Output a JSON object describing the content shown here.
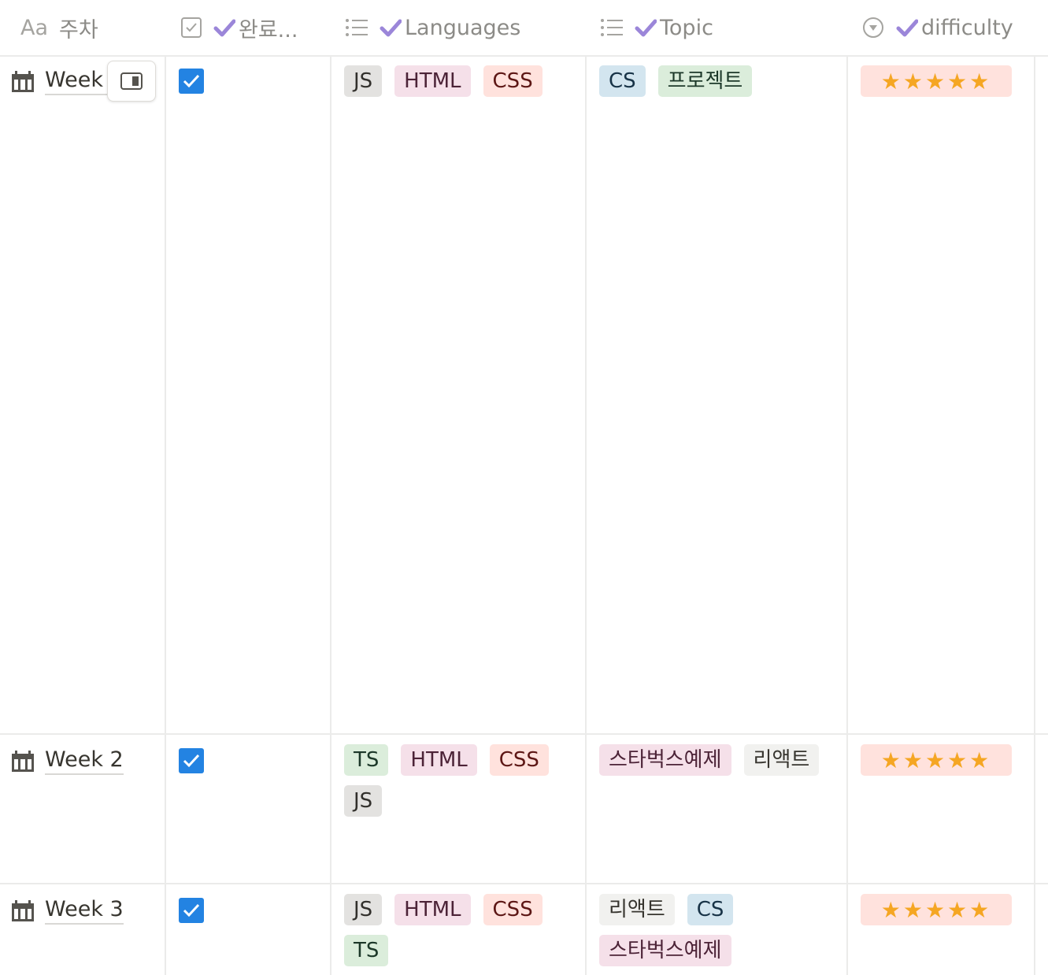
{
  "columns": {
    "name": {
      "icon": "text-icon",
      "icon_text": "Aa",
      "label": "주차"
    },
    "done": {
      "icon": "checkbox-icon",
      "label": "완료..."
    },
    "languages": {
      "icon": "list-icon",
      "label": "Languages"
    },
    "topic": {
      "icon": "list-icon",
      "label": "Topic"
    },
    "difficulty": {
      "icon": "select-icon",
      "label": "difficulty"
    }
  },
  "rows": [
    {
      "title": "Week 1",
      "done": true,
      "languages": [
        "JS",
        "HTML",
        "CSS"
      ],
      "topic": [
        "CS",
        "프로젝트"
      ],
      "difficulty": "★★★★★"
    },
    {
      "title": "Week 2",
      "done": true,
      "languages": [
        "TS",
        "HTML",
        "CSS",
        "JS"
      ],
      "topic": [
        "스타벅스예제",
        "리액트"
      ],
      "difficulty": "★★★★★"
    },
    {
      "title": "Week 3",
      "done": true,
      "languages": [
        "JS",
        "HTML",
        "CSS",
        "TS"
      ],
      "topic": [
        "리액트",
        "CS",
        "스타벅스예제"
      ],
      "difficulty": "★★★★★"
    }
  ],
  "colors": {
    "checkbox": "#2383e2",
    "check_accent": "#9b86d9",
    "star": "#f5a623",
    "star_bg": "#ffe2dd"
  }
}
